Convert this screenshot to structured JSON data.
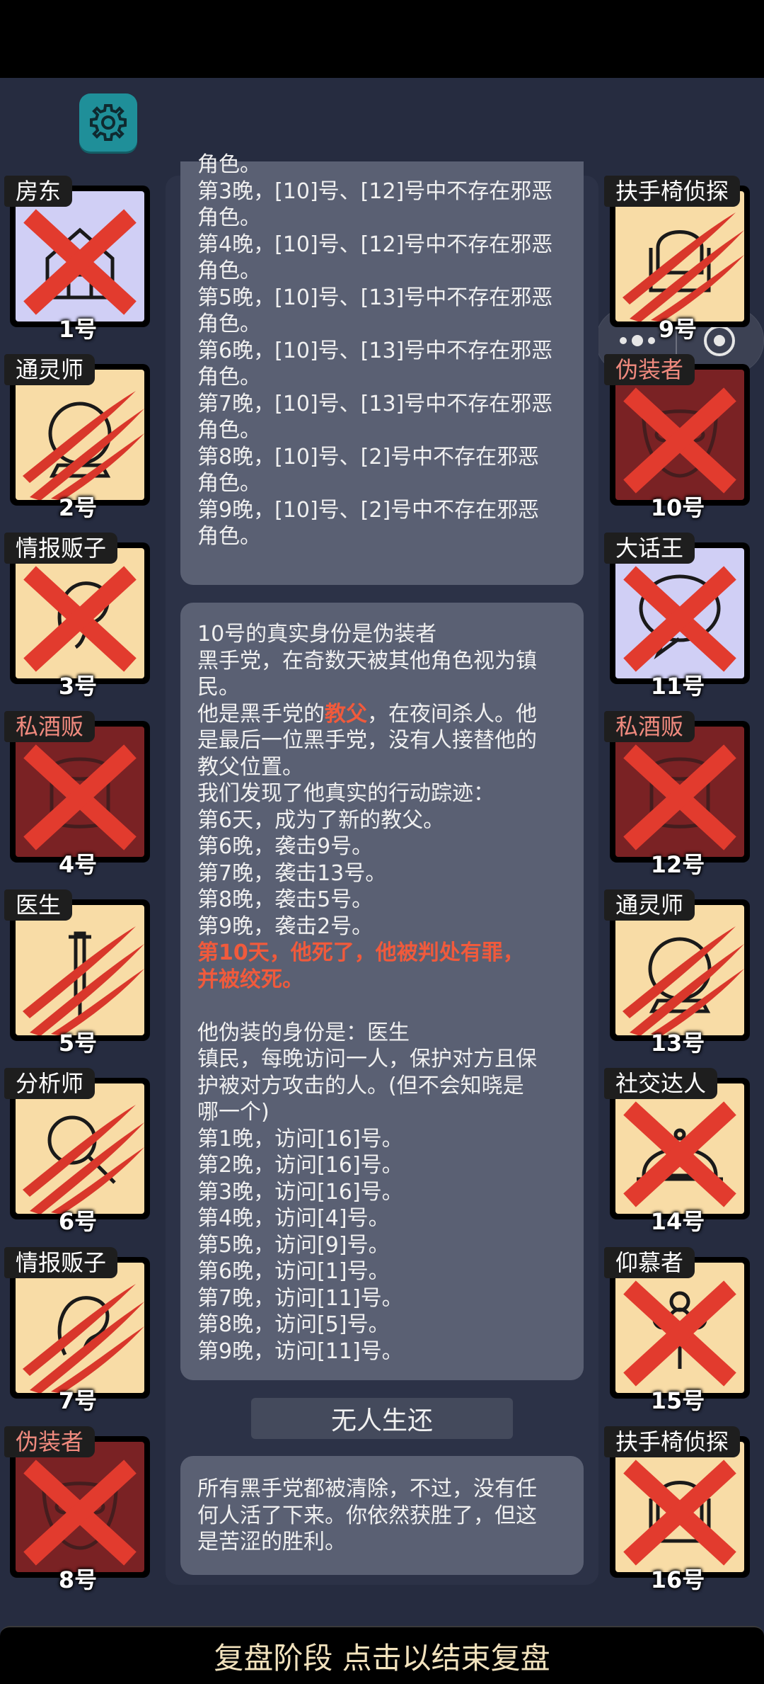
{
  "colors": {
    "good_tag": "#ffffff",
    "evil_tag": "#f08a7e",
    "cream": "#f8dca6",
    "lavender": "#d0cff5",
    "maroon": "#7a2224",
    "emphasis": "#f05a3c"
  },
  "settings_icon": "gear-icon",
  "players_left": [
    {
      "role": "房东",
      "num": "1号",
      "bg": "lavender",
      "mark": "x",
      "icon": "house-icon"
    },
    {
      "role": "通灵师",
      "num": "2号",
      "bg": "cream",
      "mark": "claw",
      "icon": "crystal-ball-icon"
    },
    {
      "role": "情报贩子",
      "num": "3号",
      "bg": "cream",
      "mark": "x",
      "icon": "ear-icon"
    },
    {
      "role": "私酒贩",
      "num": "4号",
      "bg": "maroon",
      "mark": "x",
      "icon": "barrel-icon",
      "evil": true
    },
    {
      "role": "医生",
      "num": "5号",
      "bg": "cream",
      "mark": "claw",
      "icon": "syringe-icon"
    },
    {
      "role": "分析师",
      "num": "6号",
      "bg": "cream",
      "mark": "claw",
      "icon": "magnifier-icon"
    },
    {
      "role": "情报贩子",
      "num": "7号",
      "bg": "cream",
      "mark": "claw",
      "icon": "ear-icon"
    },
    {
      "role": "伪装者",
      "num": "8号",
      "bg": "maroon",
      "mark": "x",
      "icon": "mask-icon",
      "evil": true
    }
  ],
  "players_right": [
    {
      "role": "扶手椅侦探",
      "num": "9号",
      "bg": "cream",
      "mark": "claw",
      "icon": "armchair-icon"
    },
    {
      "role": "伪装者",
      "num": "10号",
      "bg": "maroon",
      "mark": "x",
      "icon": "mask-icon",
      "evil": true
    },
    {
      "role": "大话王",
      "num": "11号",
      "bg": "lavender",
      "mark": "x",
      "icon": "speech-bubble-icon"
    },
    {
      "role": "私酒贩",
      "num": "12号",
      "bg": "maroon",
      "mark": "x",
      "icon": "barrel-icon",
      "evil": true
    },
    {
      "role": "通灵师",
      "num": "13号",
      "bg": "cream",
      "mark": "claw",
      "icon": "crystal-ball-icon"
    },
    {
      "role": "社交达人",
      "num": "14号",
      "bg": "cream",
      "mark": "x",
      "icon": "cloche-icon"
    },
    {
      "role": "仰慕者",
      "num": "15号",
      "bg": "cream",
      "mark": "x",
      "icon": "flower-icon"
    },
    {
      "role": "扶手椅侦探",
      "num": "16号",
      "bg": "cream",
      "mark": "x",
      "icon": "armchair-icon"
    }
  ],
  "log_top_lines": [
    "角色。",
    "第3晚，[10]号、[12]号中不存在邪恶",
    "角色。",
    "第4晚，[10]号、[12]号中不存在邪恶",
    "角色。",
    "第5晚，[10]号、[13]号中不存在邪恶",
    "角色。",
    "第6晚，[10]号、[13]号中不存在邪恶",
    "角色。",
    "第7晚，[10]号、[13]号中不存在邪恶",
    "角色。",
    "第8晚，[10]号、[2]号中不存在邪恶",
    "角色。",
    "第9晚，[10]号、[2]号中不存在邪恶",
    "角色。"
  ],
  "identity": {
    "l1": "10号的真实身份是伪装者",
    "l2": "黑手党，在奇数天被其他角色视为镇",
    "l3": "民。",
    "l4_a": "他是黑手党的",
    "l4_em": "教父",
    "l4_b": "，在夜间杀人。他",
    "l5": "是最后一位黑手党，没有人接替他的",
    "l6": "教父位置。",
    "l7": "我们发现了他真实的行动踪迹：",
    "l8": "第6天，成为了新的教父。",
    "l9": "第6晚，袭击9号。",
    "l10": "第7晚，袭击13号。",
    "l11": "第8晚，袭击5号。",
    "l12": "第9晚，袭击2号。",
    "l13": "第10天，他死了，他被判处有罪，",
    "l14": "并被绞死。",
    "l15": "他伪装的身份是：医生",
    "l16": "镇民，每晚访问一人，保护对方且保",
    "l17": "护被对方攻击的人。(但不会知晓是",
    "l18": "哪一个)",
    "l19": "第1晚，访问[16]号。",
    "l20": "第2晚，访问[16]号。",
    "l21": "第3晚，访问[16]号。",
    "l22": "第4晚，访问[4]号。",
    "l23": "第5晚，访问[9]号。",
    "l24": "第6晚，访问[1]号。",
    "l25": "第7晚，访问[11]号。",
    "l26": "第8晚，访问[5]号。",
    "l27": "第9晚，访问[11]号。"
  },
  "result_title": "无人生还",
  "result_text": {
    "l1": "所有黑手党都被清除，不过，没有任",
    "l2": "何人活了下来。你依然获胜了，但这",
    "l3": "是苦涩的胜利。"
  },
  "bottom_bar": "复盘阶段 点击以结束复盘"
}
